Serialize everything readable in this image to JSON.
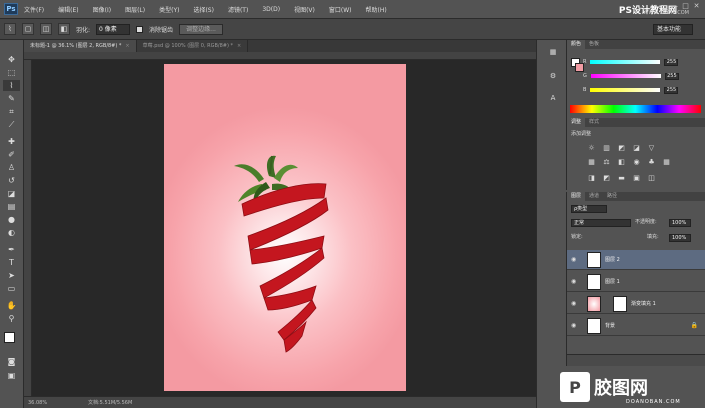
{
  "menubar": {
    "logo": "Ps",
    "items": [
      "文件(F)",
      "编辑(E)",
      "图像(I)",
      "图层(L)",
      "类型(Y)",
      "选择(S)",
      "滤镜(T)",
      "3D(D)",
      "视图(V)",
      "窗口(W)",
      "帮助(H)"
    ],
    "watermark": "PS设计教程网",
    "watermark_url": "WWW.16XX8.COM",
    "win_min": "—",
    "win_max": "□",
    "win_close": "✕"
  },
  "options": {
    "feather_label": "羽化:",
    "feather_value": "0 像素",
    "antialias_label": "消除锯齿",
    "refine_edge": "调整边缘...",
    "workspace": "基本功能"
  },
  "tabs": [
    {
      "label": "未标题-1 @ 36.1% (图层 2, RGB/8#) *"
    },
    {
      "label": "草莓.psd @ 100% (图层 0, RGB/8#) *"
    }
  ],
  "status": {
    "zoom": "36.08%",
    "docsize": "文档:5.51M/5.56M"
  },
  "color_panel": {
    "tabs": [
      "颜色",
      "色板"
    ],
    "channels": [
      {
        "label": "R",
        "value": "255"
      },
      {
        "label": "G",
        "value": "255"
      },
      {
        "label": "B",
        "value": "255"
      }
    ]
  },
  "adjust_panel": {
    "tabs": [
      "调整",
      "样式"
    ],
    "title": "添加调整"
  },
  "layers_panel": {
    "tabs": [
      "图层",
      "通道",
      "路径"
    ],
    "filter_label": "ρ类型",
    "blend_mode": "正常",
    "opacity_label": "不透明度:",
    "opacity": "100%",
    "lock_label": "锁定:",
    "fill_label": "填充:",
    "fill": "100%",
    "layers": [
      {
        "name": "图层 2",
        "selected": true
      },
      {
        "name": "图层 1",
        "selected": false
      },
      {
        "name": "渐变填充 1",
        "selected": false
      },
      {
        "name": "背景",
        "selected": false
      }
    ]
  },
  "site_logo": {
    "glyph": "P",
    "text": "胶图网",
    "url": "DOANOBAN.COM"
  }
}
